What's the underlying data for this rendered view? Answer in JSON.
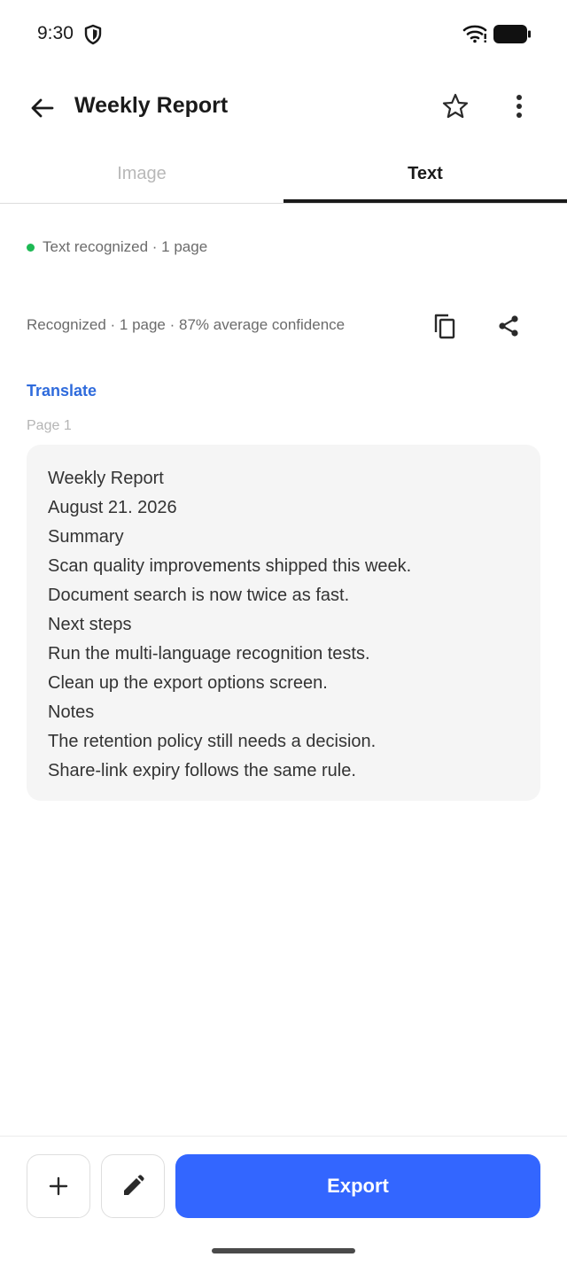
{
  "status_bar": {
    "time": "9:30",
    "icons": [
      "shield-icon",
      "wifi-icon",
      "battery-icon"
    ]
  },
  "app_bar": {
    "title": "Weekly Report",
    "icons": [
      "back-arrow-icon",
      "star-outline-icon",
      "more-vertical-icon"
    ]
  },
  "tabs": [
    {
      "label": "Image",
      "selected": false
    },
    {
      "label": "Text",
      "selected": true
    }
  ],
  "recognition": {
    "status_text": "Text recognized · 1 page",
    "status_color": "#1db954",
    "summary": "Recognized · 1 page · 87% average confidence",
    "actions": [
      "copy-icon",
      "share-icon"
    ]
  },
  "translate_label": "Translate",
  "page_label": "Page 1",
  "recognized_text": {
    "lines": [
      "Weekly Report",
      "August 21. 2026",
      "Summary",
      "Scan quality improvements shipped this week.",
      "Document search is now twice as fast.",
      "Next steps",
      "Run the multi-language recognition tests.",
      "Clean up the export options screen.",
      "Notes",
      "The retention policy still needs a decision.",
      "Share-link expiry follows the same rule."
    ]
  },
  "bottom_bar": {
    "export_label": "Export",
    "icons": [
      "plus-icon",
      "pencil-icon"
    ]
  },
  "colors": {
    "accent": "#3366ff",
    "link": "#2f6bdc",
    "card_background": "#f5f5f5"
  }
}
